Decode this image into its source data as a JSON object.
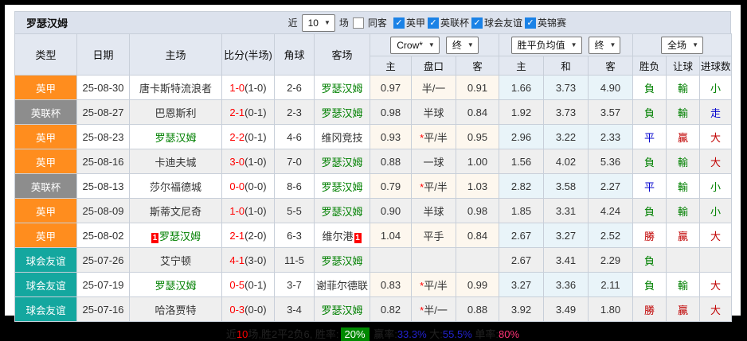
{
  "page": {
    "title": "罗瑟汉姆",
    "controls": {
      "recent_label": "近",
      "matches_select": "10",
      "matches_label": "场",
      "same_away_label": "同客",
      "same_away_checked": false,
      "league_filters": [
        {
          "label": "英甲",
          "checked": true
        },
        {
          "label": "英联杯",
          "checked": true
        },
        {
          "label": "球会友谊",
          "checked": true
        },
        {
          "label": "英锦赛",
          "checked": true
        }
      ]
    }
  },
  "table": {
    "selects": {
      "bookmaker": "Crow*",
      "asian_state": "终",
      "europe": "胜平负均值",
      "europe_state": "终",
      "scope": "全场"
    },
    "columns": [
      "类型",
      "日期",
      "主场",
      "比分(半场)",
      "角球",
      "客场",
      "主",
      "盘口",
      "客",
      "主",
      "和",
      "客",
      "胜负",
      "让球",
      "进球数"
    ],
    "rows": [
      {
        "type": "英甲",
        "type_class": "orange",
        "date": "25-08-30",
        "home": "唐卡斯特流浪者",
        "home_self": false,
        "home_redcard": "",
        "score": "1-0",
        "half": "(1-0)",
        "corner": "2-6",
        "away": "罗瑟汉姆",
        "away_self": true,
        "away_redcard": "",
        "ah_home": "0.97",
        "handicap": "半/一",
        "handicap_star": false,
        "ah_away": "0.91",
        "eu_home": "1.66",
        "eu_draw": "3.73",
        "eu_away": "4.90",
        "result": "負",
        "result_class": "green",
        "ah_result": "輸",
        "ah_result_class": "green",
        "ou_result": "小",
        "ou_result_class": "green"
      },
      {
        "type": "英联杯",
        "type_class": "gray",
        "date": "25-08-27",
        "home": "巴恩斯利",
        "home_self": false,
        "home_redcard": "",
        "score": "2-1",
        "half": "(0-1)",
        "corner": "2-3",
        "away": "罗瑟汉姆",
        "away_self": true,
        "away_redcard": "",
        "ah_home": "0.98",
        "handicap": "半球",
        "handicap_star": false,
        "ah_away": "0.84",
        "eu_home": "1.92",
        "eu_draw": "3.73",
        "eu_away": "3.57",
        "result": "負",
        "result_class": "green",
        "ah_result": "輸",
        "ah_result_class": "green",
        "ou_result": "走",
        "ou_result_class": "blue"
      },
      {
        "type": "英甲",
        "type_class": "orange",
        "date": "25-08-23",
        "home": "罗瑟汉姆",
        "home_self": true,
        "home_redcard": "",
        "score": "2-2",
        "half": "(0-1)",
        "corner": "4-6",
        "away": "维冈竞技",
        "away_self": false,
        "away_redcard": "",
        "ah_home": "0.93",
        "handicap": "平/半",
        "handicap_star": true,
        "ah_away": "0.95",
        "eu_home": "2.96",
        "eu_draw": "3.22",
        "eu_away": "2.33",
        "result": "平",
        "result_class": "blue",
        "ah_result": "贏",
        "ah_result_class": "red",
        "ou_result": "大",
        "ou_result_class": "red"
      },
      {
        "type": "英甲",
        "type_class": "orange",
        "date": "25-08-16",
        "home": "卡迪夫城",
        "home_self": false,
        "home_redcard": "",
        "score": "3-0",
        "half": "(1-0)",
        "corner": "7-0",
        "away": "罗瑟汉姆",
        "away_self": true,
        "away_redcard": "",
        "ah_home": "0.88",
        "handicap": "一球",
        "handicap_star": false,
        "ah_away": "1.00",
        "eu_home": "1.56",
        "eu_draw": "4.02",
        "eu_away": "5.36",
        "result": "負",
        "result_class": "green",
        "ah_result": "輸",
        "ah_result_class": "green",
        "ou_result": "大",
        "ou_result_class": "red"
      },
      {
        "type": "英联杯",
        "type_class": "gray",
        "date": "25-08-13",
        "home": "莎尔福德城",
        "home_self": false,
        "home_redcard": "",
        "score": "0-0",
        "half": "(0-0)",
        "corner": "8-6",
        "away": "罗瑟汉姆",
        "away_self": true,
        "away_redcard": "",
        "ah_home": "0.79",
        "handicap": "平/半",
        "handicap_star": true,
        "ah_away": "1.03",
        "eu_home": "2.82",
        "eu_draw": "3.58",
        "eu_away": "2.27",
        "result": "平",
        "result_class": "blue",
        "ah_result": "輸",
        "ah_result_class": "green",
        "ou_result": "小",
        "ou_result_class": "green"
      },
      {
        "type": "英甲",
        "type_class": "orange",
        "date": "25-08-09",
        "home": "斯蒂文尼奇",
        "home_self": false,
        "home_redcard": "",
        "score": "1-0",
        "half": "(1-0)",
        "corner": "5-5",
        "away": "罗瑟汉姆",
        "away_self": true,
        "away_redcard": "",
        "ah_home": "0.90",
        "handicap": "半球",
        "handicap_star": false,
        "ah_away": "0.98",
        "eu_home": "1.85",
        "eu_draw": "3.31",
        "eu_away": "4.24",
        "result": "負",
        "result_class": "green",
        "ah_result": "輸",
        "ah_result_class": "green",
        "ou_result": "小",
        "ou_result_class": "green"
      },
      {
        "type": "英甲",
        "type_class": "orange",
        "date": "25-08-02",
        "home": "罗瑟汉姆",
        "home_self": true,
        "home_redcard": "1",
        "score": "2-1",
        "half": "(2-0)",
        "corner": "6-3",
        "away": "维尔港",
        "away_self": false,
        "away_redcard": "1",
        "ah_home": "1.04",
        "handicap": "平手",
        "handicap_star": false,
        "ah_away": "0.84",
        "eu_home": "2.67",
        "eu_draw": "3.27",
        "eu_away": "2.52",
        "result": "勝",
        "result_class": "red",
        "ah_result": "贏",
        "ah_result_class": "red",
        "ou_result": "大",
        "ou_result_class": "red"
      },
      {
        "type": "球会友谊",
        "type_class": "teal",
        "date": "25-07-26",
        "home": "艾宁顿",
        "home_self": false,
        "home_redcard": "",
        "score": "4-1",
        "half": "(3-0)",
        "corner": "11-5",
        "away": "罗瑟汉姆",
        "away_self": true,
        "away_redcard": "",
        "ah_home": "",
        "handicap": "",
        "handicap_star": false,
        "ah_away": "",
        "eu_home": "2.67",
        "eu_draw": "3.41",
        "eu_away": "2.29",
        "result": "負",
        "result_class": "green",
        "ah_result": "",
        "ah_result_class": "",
        "ou_result": "",
        "ou_result_class": ""
      },
      {
        "type": "球会友谊",
        "type_class": "teal",
        "date": "25-07-19",
        "home": "罗瑟汉姆",
        "home_self": true,
        "home_redcard": "",
        "score": "0-5",
        "half": "(0-1)",
        "corner": "3-7",
        "away": "谢菲尔德联",
        "away_self": false,
        "away_redcard": "",
        "ah_home": "0.83",
        "handicap": "平/半",
        "handicap_star": true,
        "ah_away": "0.99",
        "eu_home": "3.27",
        "eu_draw": "3.36",
        "eu_away": "2.11",
        "result": "負",
        "result_class": "green",
        "ah_result": "輸",
        "ah_result_class": "green",
        "ou_result": "大",
        "ou_result_class": "red"
      },
      {
        "type": "球会友谊",
        "type_class": "teal",
        "date": "25-07-16",
        "home": "哈洛贾特",
        "home_self": false,
        "home_redcard": "",
        "score": "0-3",
        "half": "(0-0)",
        "corner": "3-4",
        "away": "罗瑟汉姆",
        "away_self": true,
        "away_redcard": "",
        "ah_home": "0.82",
        "handicap": "半/一",
        "handicap_star": true,
        "ah_away": "0.88",
        "eu_home": "3.92",
        "eu_draw": "3.49",
        "eu_away": "1.80",
        "result": "勝",
        "result_class": "red",
        "ah_result": "贏",
        "ah_result_class": "red",
        "ou_result": "大",
        "ou_result_class": "red"
      }
    ]
  },
  "summary": {
    "segments": [
      {
        "text": "近",
        "style": "plain"
      },
      {
        "text": "10",
        "style": "red"
      },
      {
        "text": "场,胜2平2负6, 胜率:",
        "style": "plain"
      },
      {
        "text": "20%",
        "style": "badge-green"
      },
      {
        "text": " 赢率:",
        "style": "plain"
      },
      {
        "text": "33.3%",
        "style": "blue"
      },
      {
        "text": " 大:",
        "style": "plain"
      },
      {
        "text": "55.5%",
        "style": "blue"
      },
      {
        "text": " 单率:",
        "style": "plain"
      },
      {
        "text": "80%",
        "style": "pink"
      }
    ]
  },
  "colors": {
    "league_orange": "#ff8d1e",
    "cup_gray": "#8d8d8d",
    "friendly_teal": "#14a79f",
    "self_green": "#008000",
    "score_red": "#ff0000",
    "res_green": "#008000",
    "res_blue": "#0000cc",
    "res_red": "#c00000",
    "asian_bg": "#fdf7ee",
    "euro_bg": "#e9f4f9",
    "header_bg": "#e3e8f1",
    "titlebar_bg": "#dce2ed",
    "border": "#c8cfd9",
    "row_alt": "#efefef",
    "checkbox_blue": "#1b82e6",
    "badge_green": "#008800"
  }
}
